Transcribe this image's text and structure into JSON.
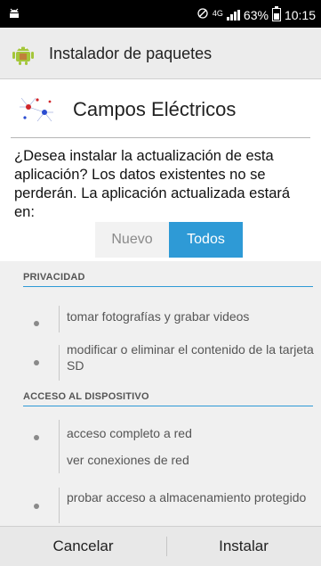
{
  "status_bar": {
    "notification_icon": "android-debug-icon",
    "network_generation": "4G",
    "battery_percent": "63%",
    "time": "10:15",
    "battery_level": 0.63
  },
  "title_bar": {
    "icon": "android-package-installer-icon",
    "title": "Instalador de paquetes"
  },
  "app": {
    "icon": "electric-field-logo",
    "name": "Campos Eléctricos"
  },
  "question": "¿Desea instalar la actualización de esta aplicación? Los datos existentes no se perderán. La aplicación actualizada estará en:",
  "tabs": [
    {
      "label": "Nuevo",
      "selected": false
    },
    {
      "label": "Todos",
      "selected": true
    }
  ],
  "sections": [
    {
      "title": "PRIVACIDAD",
      "permissions": [
        {
          "text": "tomar fotografías y grabar videos"
        },
        {
          "text": "modificar o eliminar el contenido de la tarjeta SD"
        }
      ]
    },
    {
      "title": "ACCESO AL DISPOSITIVO",
      "permissions": [
        {
          "text": "acceso completo a red"
        },
        {
          "text": "ver conexiones de red"
        },
        {
          "text": "probar acceso a almacenamiento protegido"
        }
      ]
    }
  ],
  "buttons": {
    "cancel": "Cancelar",
    "install": "Instalar"
  },
  "colors": {
    "accent": "#2e9ad6",
    "android_green": "#a4c639"
  }
}
